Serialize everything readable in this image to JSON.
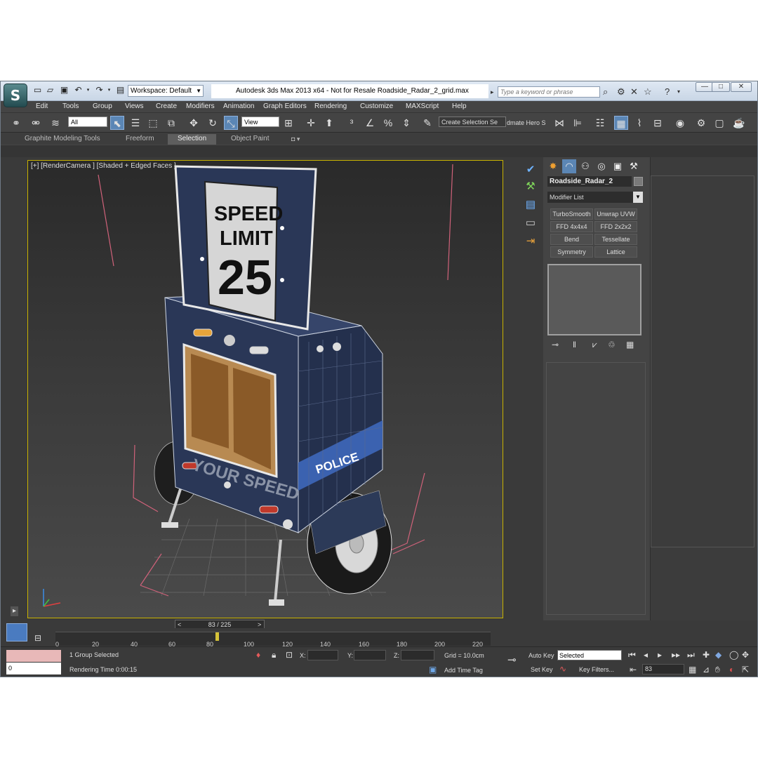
{
  "window": {
    "title": "Autodesk 3ds Max  2013 x64  - Not for Resale     Roadside_Radar_2_grid.max",
    "workspace": "Workspace: Default",
    "search_placeholder": "Type a keyword or phrase",
    "logo_letter": "S"
  },
  "menu": [
    "Edit",
    "Tools",
    "Group",
    "Views",
    "Create",
    "Modifiers",
    "Animation",
    "Graph Editors",
    "Rendering",
    "Customize",
    "MAXScript",
    "Help"
  ],
  "toolbar": {
    "selection_filter": "All",
    "ref_coord": "View",
    "named_selection": "Create Selection Se",
    "extra_label": "dmate Hero S"
  },
  "ribbon_tabs": [
    "Graphite Modeling Tools",
    "Freeform",
    "Selection",
    "Object Paint"
  ],
  "viewport": {
    "label": "[+] [RenderCamera ] [Shaded + Edged Faces ]",
    "sign_line1": "SPEED",
    "sign_line2": "LIMIT",
    "sign_number": "25",
    "panel_text": "YOUR SPEED",
    "stripe_text": "POLICE"
  },
  "command_panel": {
    "object_name": "Roadside_Radar_2",
    "modifier_list": "Modifier List",
    "modifiers": [
      "TurboSmooth",
      "Unwrap UVW",
      "FFD 4x4x4",
      "FFD 2x2x2",
      "Bend",
      "Tessellate",
      "Symmetry",
      "Lattice"
    ]
  },
  "timeline": {
    "frame_counter": "83 / 225",
    "ticks": [
      "0",
      "20",
      "40",
      "60",
      "80",
      "100",
      "120",
      "140",
      "160",
      "180",
      "200",
      "220"
    ]
  },
  "status": {
    "listener_value": "0",
    "selection_info": "1 Group Selected",
    "rendering_time": "Rendering Time  0:00:15",
    "x_label": "X:",
    "y_label": "Y:",
    "z_label": "Z:",
    "grid": "Grid = 10.0cm",
    "add_time_tag": "Add Time Tag",
    "auto_key": "Auto Key",
    "set_key": "Set Key",
    "key_mode": "Selected",
    "key_filters": "Key Filters...",
    "current_frame": "83"
  }
}
